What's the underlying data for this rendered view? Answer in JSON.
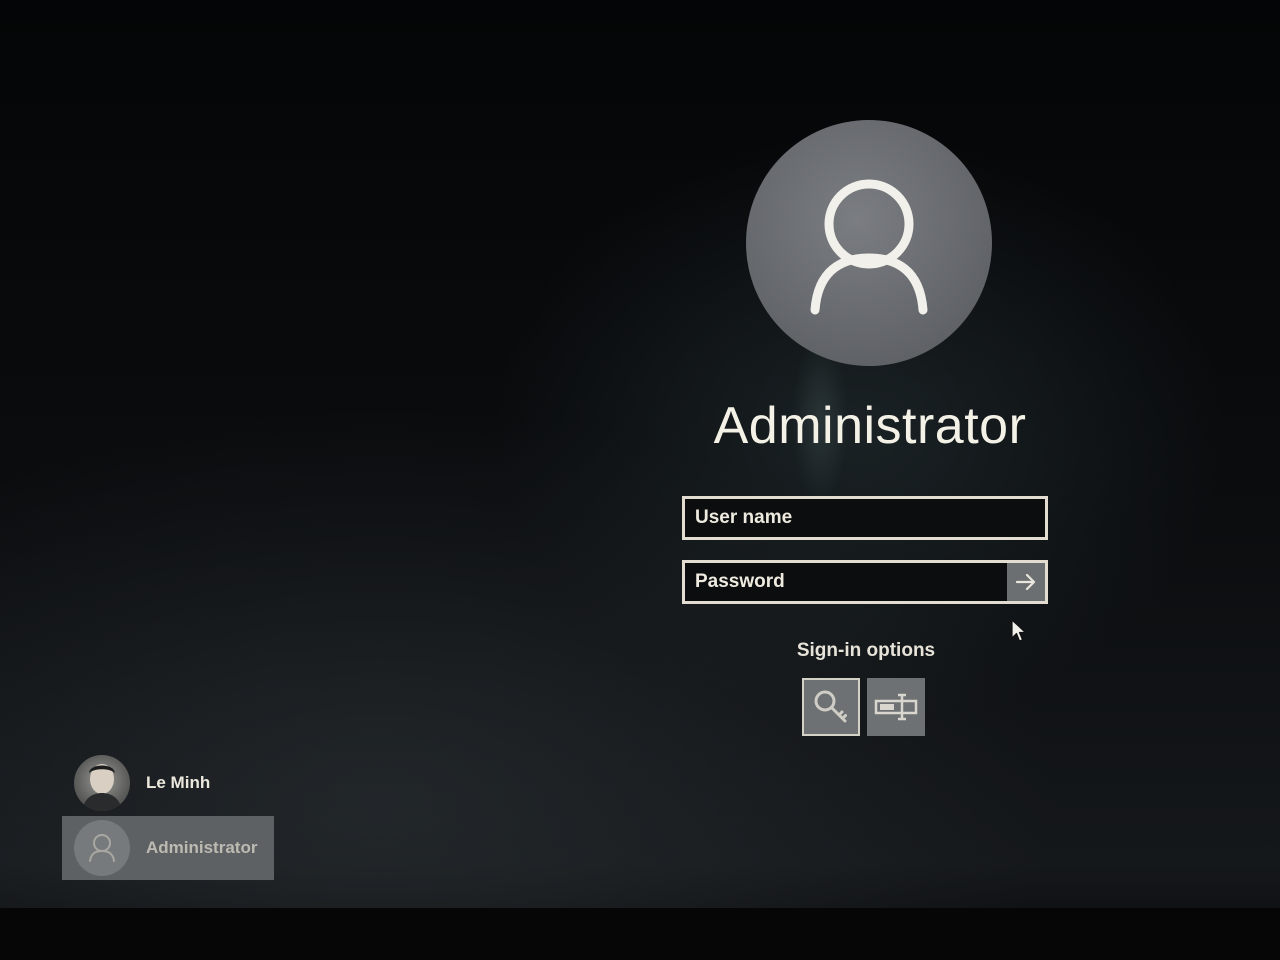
{
  "login": {
    "user_display_name": "Administrator",
    "username_placeholder": "User name",
    "password_placeholder": "Password",
    "signin_options_label": "Sign-in options",
    "signin_options": [
      {
        "icon": "key-icon"
      },
      {
        "icon": "certificate-icon"
      }
    ],
    "submit_icon": "arrow-right-icon"
  },
  "user_list": [
    {
      "name": "Le Minh",
      "avatar": "photo-avatar",
      "selected": false
    },
    {
      "name": "Administrator",
      "avatar": "default-user-icon",
      "selected": true
    }
  ],
  "colors": {
    "field_border": "#e2ddd0",
    "submit_button": "#6c6f71",
    "selected_tile": "#5d6163",
    "avatar": "#6e7175"
  }
}
